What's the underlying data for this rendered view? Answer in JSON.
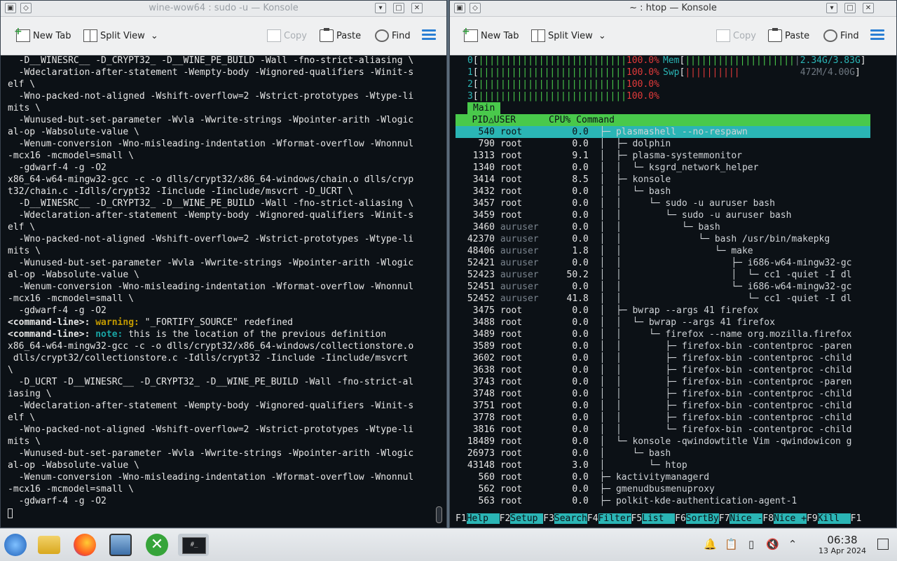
{
  "left_window": {
    "title": "wine-wow64 : sudo -u — Konsole",
    "toolbar": {
      "new_tab": "New Tab",
      "split_view": "Split View",
      "copy": "Copy",
      "paste": "Paste",
      "find": "Find"
    },
    "lines": [
      "  -D__WINESRC__ -D_CRYPT32_ -D__WINE_PE_BUILD -Wall -fno-strict-aliasing \\",
      "  -Wdeclaration-after-statement -Wempty-body -Wignored-qualifiers -Winit-s",
      "elf \\",
      "  -Wno-packed-not-aligned -Wshift-overflow=2 -Wstrict-prototypes -Wtype-li",
      "mits \\",
      "  -Wunused-but-set-parameter -Wvla -Wwrite-strings -Wpointer-arith -Wlogic",
      "al-op -Wabsolute-value \\",
      "  -Wenum-conversion -Wno-misleading-indentation -Wformat-overflow -Wnonnul",
      "-mcx16 -mcmodel=small \\",
      "  -gdwarf-4 -g -O2",
      "x86_64-w64-mingw32-gcc -c -o dlls/crypt32/x86_64-windows/chain.o dlls/cryp",
      "t32/chain.c -Idlls/crypt32 -Iinclude -Iinclude/msvcrt -D_UCRT \\",
      "  -D__WINESRC__ -D_CRYPT32_ -D__WINE_PE_BUILD -Wall -fno-strict-aliasing \\",
      "  -Wdeclaration-after-statement -Wempty-body -Wignored-qualifiers -Winit-s",
      "elf \\",
      "  -Wno-packed-not-aligned -Wshift-overflow=2 -Wstrict-prototypes -Wtype-li",
      "mits \\",
      "  -Wunused-but-set-parameter -Wvla -Wwrite-strings -Wpointer-arith -Wlogic",
      "al-op -Wabsolute-value \\",
      "  -Wenum-conversion -Wno-misleading-indentation -Wformat-overflow -Wnonnul",
      "-mcx16 -mcmodel=small \\",
      "  -gdwarf-4 -g -O2"
    ],
    "warning_line": {
      "prefix": "<command-line>:",
      "kind": "warning:",
      "text": " \"_FORTIFY_SOURCE\" redefined"
    },
    "note_line": {
      "prefix": "<command-line>:",
      "kind": "note:",
      "text": " this is the location of the previous definition"
    },
    "lines_after": [
      "x86_64-w64-mingw32-gcc -c -o dlls/crypt32/x86_64-windows/collectionstore.o",
      " dlls/crypt32/collectionstore.c -Idlls/crypt32 -Iinclude -Iinclude/msvcrt",
      "\\",
      "  -D_UCRT -D__WINESRC__ -D_CRYPT32_ -D__WINE_PE_BUILD -Wall -fno-strict-al",
      "iasing \\",
      "  -Wdeclaration-after-statement -Wempty-body -Wignored-qualifiers -Winit-s",
      "elf \\",
      "  -Wno-packed-not-aligned -Wshift-overflow=2 -Wstrict-prototypes -Wtype-li",
      "mits \\",
      "  -Wunused-but-set-parameter -Wvla -Wwrite-strings -Wpointer-arith -Wlogic",
      "al-op -Wabsolute-value \\",
      "  -Wenum-conversion -Wno-misleading-indentation -Wformat-overflow -Wnonnul",
      "-mcx16 -mcmodel=small \\",
      "  -gdwarf-4 -g -O2"
    ]
  },
  "right_window": {
    "title": "~ : htop — Konsole",
    "toolbar": {
      "new_tab": "New Tab",
      "split_view": "Split View",
      "copy": "Copy",
      "paste": "Paste",
      "find": "Find"
    },
    "cpus": [
      {
        "id": "0",
        "bars": "|||||||||||||||||||||||||||",
        "pct": "100.0%"
      },
      {
        "id": "1",
        "bars": "|||||||||||||||||||||||||||",
        "pct": "100.0%"
      },
      {
        "id": "2",
        "bars": "|||||||||||||||||||||||||||",
        "pct": "100.0%"
      },
      {
        "id": "3",
        "bars": "|||||||||||||||||||||||||||",
        "pct": "100.0%"
      }
    ],
    "mem": {
      "label": "Mem",
      "bars": "||||||||||||||||||||",
      "value": "2.34G/3.83G"
    },
    "swp": {
      "label": "Swp",
      "bars": "||||||||||",
      "value": "472M/4.00G"
    },
    "tab": "Main",
    "header": "   PID△USER      CPU% Command",
    "processes": [
      {
        "pid": "540",
        "user": "root",
        "cpu": "0.0",
        "cmd": "  ├─ plasmashell --no-respawn"
      },
      {
        "pid": "790",
        "user": "root",
        "cpu": "0.0",
        "cmd": "  │  ├─ dolphin"
      },
      {
        "pid": "1313",
        "user": "root",
        "cpu": "9.1",
        "cmd": "  │  ├─ plasma-systemmonitor"
      },
      {
        "pid": "1340",
        "user": "root",
        "cpu": "0.0",
        "cmd": "  │  │  └─ ksgrd_network_helper"
      },
      {
        "pid": "3414",
        "user": "root",
        "cpu": "8.5",
        "cmd": "  │  ├─ konsole"
      },
      {
        "pid": "3432",
        "user": "root",
        "cpu": "0.0",
        "cmd": "  │  │  └─ bash"
      },
      {
        "pid": "3457",
        "user": "root",
        "cpu": "0.0",
        "cmd": "  │  │     └─ sudo -u auruser bash"
      },
      {
        "pid": "3459",
        "user": "root",
        "cpu": "0.0",
        "cmd": "  │  │        └─ sudo -u auruser bash"
      },
      {
        "pid": "3460",
        "user": "auruser",
        "cpu": "0.0",
        "cmd": "  │  │           └─ bash"
      },
      {
        "pid": "42370",
        "user": "auruser",
        "cpu": "0.0",
        "cmd": "  │  │              └─ bash /usr/bin/makepkg"
      },
      {
        "pid": "48406",
        "user": "auruser",
        "cpu": "1.8",
        "cmd": "  │  │                 └─ make"
      },
      {
        "pid": "52421",
        "user": "auruser",
        "cpu": "0.0",
        "cmd": "  │  │                    ├─ i686-w64-mingw32-gc"
      },
      {
        "pid": "52423",
        "user": "auruser",
        "cpu": "50.2",
        "cmd": "  │  │                    │  └─ cc1 -quiet -I dl"
      },
      {
        "pid": "52451",
        "user": "auruser",
        "cpu": "0.0",
        "cmd": "  │  │                    └─ i686-w64-mingw32-gc"
      },
      {
        "pid": "52452",
        "user": "auruser",
        "cpu": "41.8",
        "cmd": "  │  │                       └─ cc1 -quiet -I dl"
      },
      {
        "pid": "3475",
        "user": "root",
        "cpu": "0.0",
        "cmd": "  │  ├─ bwrap --args 41 firefox"
      },
      {
        "pid": "3488",
        "user": "root",
        "cpu": "0.0",
        "cmd": "  │  │  └─ bwrap --args 41 firefox"
      },
      {
        "pid": "3489",
        "user": "root",
        "cpu": "0.0",
        "cmd": "  │  │     └─ firefox --name org.mozilla.firefox"
      },
      {
        "pid": "3589",
        "user": "root",
        "cpu": "0.0",
        "cmd": "  │  │        ├─ firefox-bin -contentproc -paren"
      },
      {
        "pid": "3602",
        "user": "root",
        "cpu": "0.0",
        "cmd": "  │  │        ├─ firefox-bin -contentproc -child"
      },
      {
        "pid": "3638",
        "user": "root",
        "cpu": "0.0",
        "cmd": "  │  │        ├─ firefox-bin -contentproc -child"
      },
      {
        "pid": "3743",
        "user": "root",
        "cpu": "0.0",
        "cmd": "  │  │        ├─ firefox-bin -contentproc -paren"
      },
      {
        "pid": "3748",
        "user": "root",
        "cpu": "0.0",
        "cmd": "  │  │        ├─ firefox-bin -contentproc -child"
      },
      {
        "pid": "3751",
        "user": "root",
        "cpu": "0.0",
        "cmd": "  │  │        ├─ firefox-bin -contentproc -child"
      },
      {
        "pid": "3778",
        "user": "root",
        "cpu": "0.0",
        "cmd": "  │  │        ├─ firefox-bin -contentproc -child"
      },
      {
        "pid": "3816",
        "user": "root",
        "cpu": "0.0",
        "cmd": "  │  │        └─ firefox-bin -contentproc -child"
      },
      {
        "pid": "18489",
        "user": "root",
        "cpu": "0.0",
        "cmd": "  │  └─ konsole -qwindowtitle Vim -qwindowicon g"
      },
      {
        "pid": "26973",
        "user": "root",
        "cpu": "0.0",
        "cmd": "  │     └─ bash"
      },
      {
        "pid": "43148",
        "user": "root",
        "cpu": "3.0",
        "cmd": "  │        └─ htop"
      },
      {
        "pid": "560",
        "user": "root",
        "cpu": "0.0",
        "cmd": "  ├─ kactivitymanagerd"
      },
      {
        "pid": "562",
        "user": "root",
        "cpu": "0.0",
        "cmd": "  ├─ gmenudbusmenuproxy"
      },
      {
        "pid": "563",
        "user": "root",
        "cpu": "0.0",
        "cmd": "  ├─ polkit-kde-authentication-agent-1"
      }
    ],
    "fkeys": [
      {
        "key": "F1",
        "label": "Help  "
      },
      {
        "key": "F2",
        "label": "Setup "
      },
      {
        "key": "F3",
        "label": "Search"
      },
      {
        "key": "F4",
        "label": "Filter"
      },
      {
        "key": "F5",
        "label": "List  "
      },
      {
        "key": "F6",
        "label": "SortBy"
      },
      {
        "key": "F7",
        "label": "Nice -"
      },
      {
        "key": "F8",
        "label": "Nice +"
      },
      {
        "key": "F9",
        "label": "Kill  "
      },
      {
        "key": "F1",
        "label": ""
      }
    ]
  },
  "taskbar": {
    "time": "06:38",
    "date": "13 Apr 2024",
    "apps": [
      "start-menu-icon",
      "file-manager-icon",
      "firefox-icon",
      "system-monitor-icon",
      "close-app-icon",
      "terminal-icon"
    ]
  },
  "colors": {
    "green": "#49c94b",
    "cyan": "#2ab5b5",
    "red": "#e33a3a",
    "yellow": "#c39a00",
    "bg": "#0c1116"
  }
}
